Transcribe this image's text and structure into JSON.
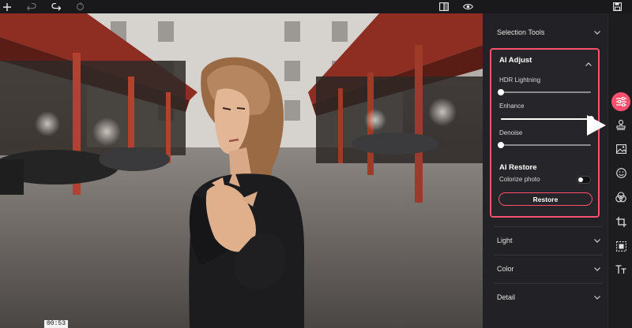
{
  "toolbar": {
    "add_icon": "plus-icon",
    "undo_icon": "undo-icon",
    "redo_icon": "redo-icon",
    "reset_icon": "reset-icon",
    "compare_icon": "compare-icon",
    "preview_icon": "eye-icon",
    "save_icon": "save-icon"
  },
  "canvas": {
    "timestamp": "00:53"
  },
  "panel": {
    "selection_tools": "Selection Tools",
    "ai_adjust": {
      "title": "AI Adjust",
      "sliders": [
        {
          "label": "HDR Lightning",
          "value": 0
        },
        {
          "label": "Enhance",
          "value": 100
        },
        {
          "label": "Denoise",
          "value": 0
        }
      ]
    },
    "ai_restore": {
      "title": "AI Restore",
      "colorize_label": "Colorize photo",
      "colorize_on": false,
      "restore_button": "Restore"
    },
    "light": "Light",
    "color": "Color",
    "detail": "Detail"
  },
  "rail": {
    "items": [
      {
        "icon": "sliders-icon",
        "active": true
      },
      {
        "icon": "stamp-icon",
        "active": false
      },
      {
        "icon": "image-icon",
        "active": false
      },
      {
        "icon": "face-icon",
        "active": false
      },
      {
        "icon": "color-circles-icon",
        "active": false
      },
      {
        "icon": "crop-icon",
        "active": false
      },
      {
        "icon": "frame-icon",
        "active": false
      },
      {
        "icon": "text-icon",
        "active": false
      }
    ]
  },
  "colors": {
    "accent": "#ff4f6e",
    "panel_bg": "#222226",
    "toolbar_bg": "#19191b"
  }
}
